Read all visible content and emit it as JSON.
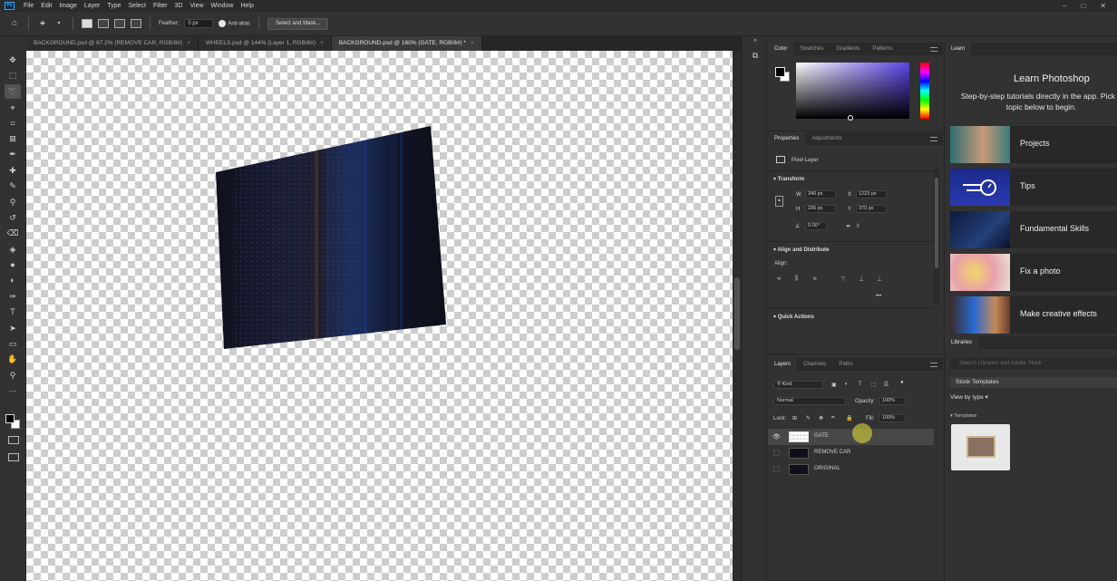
{
  "app": {
    "logo": "Ps",
    "menu": [
      "File",
      "Edit",
      "Image",
      "Layer",
      "Type",
      "Select",
      "Filter",
      "3D",
      "View",
      "Window",
      "Help"
    ],
    "window_controls": [
      "–",
      "□",
      "✕"
    ]
  },
  "options_bar": {
    "feather_label": "Feather:",
    "feather_value": "0 px",
    "antialias_label": "Anti-alias",
    "select_mask_label": "Select and Mask..."
  },
  "tabs": [
    {
      "label": "BACKGROUND.psd @ 67.2% (REMOVE CAR, RGB/8#)",
      "active": false
    },
    {
      "label": "WHEELS.psd @ 144% (Layer 1, RGB/8#)",
      "active": false
    },
    {
      "label": "BACKGROUND.psd @ 160% (GATE, RGB/8#) *",
      "active": true
    }
  ],
  "color_panel": {
    "tabs": [
      "Color",
      "Swatches",
      "Gradients",
      "Patterns"
    ]
  },
  "properties_panel": {
    "tabs": [
      "Properties",
      "Adjustments"
    ],
    "layer_type": "Pixel Layer",
    "transform_label": "Transform",
    "w_label": "W",
    "w_value": "240 px",
    "h_label": "H",
    "h_value": "236 px",
    "x_label": "X",
    "x_value": "1223 px",
    "y_label": "Y",
    "y_value": "370 px",
    "angle_value": "0.00°",
    "align_section": "Align and Distribute",
    "align_label": "Align:",
    "quick_actions": "Quick Actions"
  },
  "layers_panel": {
    "tabs": [
      "Layers",
      "Channels",
      "Paths"
    ],
    "kind_label": "Kind",
    "blend_mode": "Normal",
    "opacity_label": "Opacity:",
    "opacity_value": "100%",
    "lock_label": "Lock:",
    "fill_label": "Fill:",
    "fill_value": "100%",
    "layers": [
      {
        "name": "GATE",
        "visible": true,
        "selected": true
      },
      {
        "name": "REMOVE CAR",
        "visible": false,
        "selected": false
      },
      {
        "name": "ORIGINAL",
        "visible": false,
        "selected": false
      }
    ]
  },
  "learn_panel": {
    "tab": "Learn",
    "title": "Learn Photoshop",
    "subtitle": "Step-by-step tutorials directly in the app. Pick a topic below to begin.",
    "items": [
      "Projects",
      "Tips",
      "Fundamental Skills",
      "Fix a photo",
      "Make creative effects"
    ]
  },
  "libraries_panel": {
    "tab": "Libraries",
    "search_placeholder": "Search Libraries and Adobe Stock",
    "selected_library": "Stock Templates",
    "view_by": "View by type",
    "section": "Templates"
  }
}
